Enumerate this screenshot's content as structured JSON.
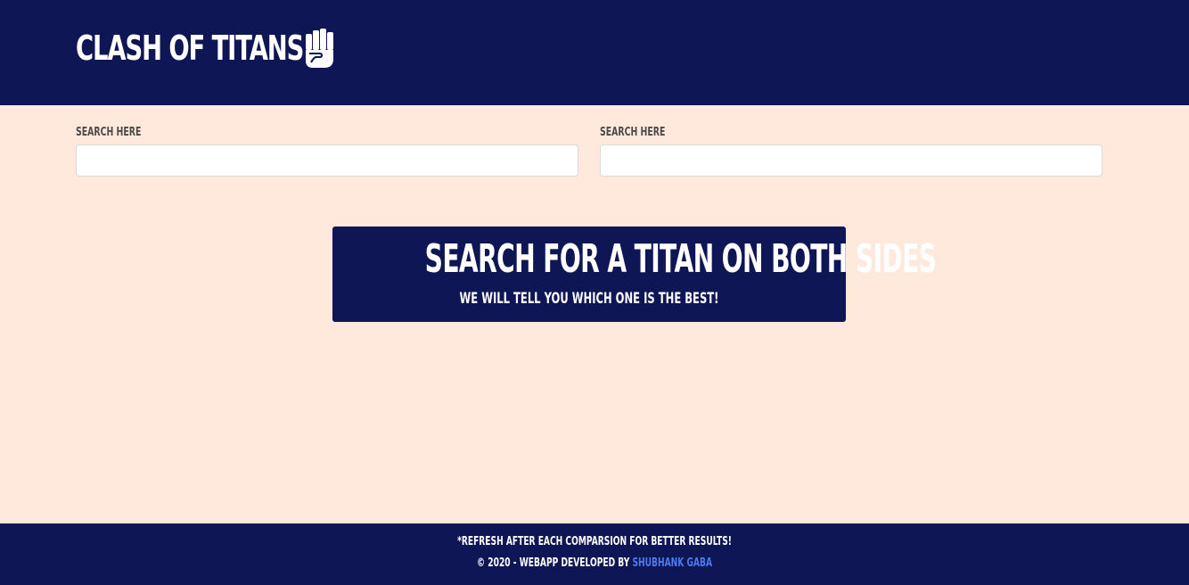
{
  "header": {
    "title": "CLASH OF TITANS",
    "icon": "fist-icon"
  },
  "search": {
    "left": {
      "label": "SEARCH HERE",
      "value": "",
      "placeholder": ""
    },
    "right": {
      "label": "SEARCH HERE",
      "value": "",
      "placeholder": ""
    }
  },
  "banner": {
    "title": "SEARCH FOR A TITAN ON BOTH SIDES",
    "subtitle": "WE WILL TELL YOU WHICH ONE IS THE BEST!"
  },
  "footer": {
    "note": "*REFRESH AFTER EACH COMPARSION FOR BETTER RESULTS!",
    "credit_prefix": "© 2020 - WEBAPP DEVELOPED BY ",
    "author": "SHUBHANK GABA"
  },
  "colors": {
    "navy": "#0e1656",
    "background": "#ffe9dc",
    "link": "#4b7bec"
  }
}
